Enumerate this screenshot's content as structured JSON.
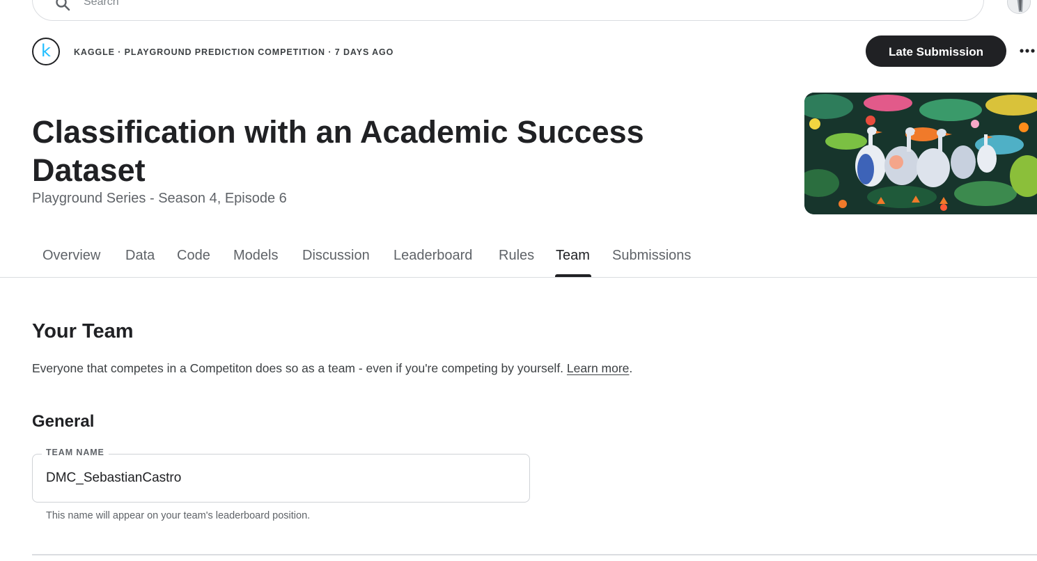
{
  "search": {
    "placeholder": "Search"
  },
  "header": {
    "logo_letter": "k",
    "meta": "KAGGLE · PLAYGROUND PREDICTION COMPETITION · 7 DAYS AGO",
    "late_submission_label": "Late Submission",
    "more_icon": "more-horizontal-icon"
  },
  "competition": {
    "title": "Classification with an Academic Success Dataset",
    "subtitle": "Playground Series - Season 4, Episode 6"
  },
  "tabs": [
    {
      "label": "Overview",
      "active": false
    },
    {
      "label": "Data",
      "active": false
    },
    {
      "label": "Code",
      "active": false
    },
    {
      "label": "Models",
      "active": false
    },
    {
      "label": "Discussion",
      "active": false
    },
    {
      "label": "Leaderboard",
      "active": false
    },
    {
      "label": "Rules",
      "active": false
    },
    {
      "label": "Team",
      "active": true
    },
    {
      "label": "Submissions",
      "active": false
    }
  ],
  "team": {
    "heading": "Your Team",
    "description": "Everyone that competes in a Competiton does so as a team - even if you're competing by yourself.",
    "learn_more": "Learn more",
    "description_end": ".",
    "general_heading": "General",
    "team_name_label": "TEAM NAME",
    "team_name_value": "DMC_SebastianCastro",
    "helper": "This name will appear on your team's leaderboard position."
  },
  "colors": {
    "primary_button": "#202124",
    "kaggle_blue": "#20beff",
    "text_secondary": "#5f6368"
  }
}
